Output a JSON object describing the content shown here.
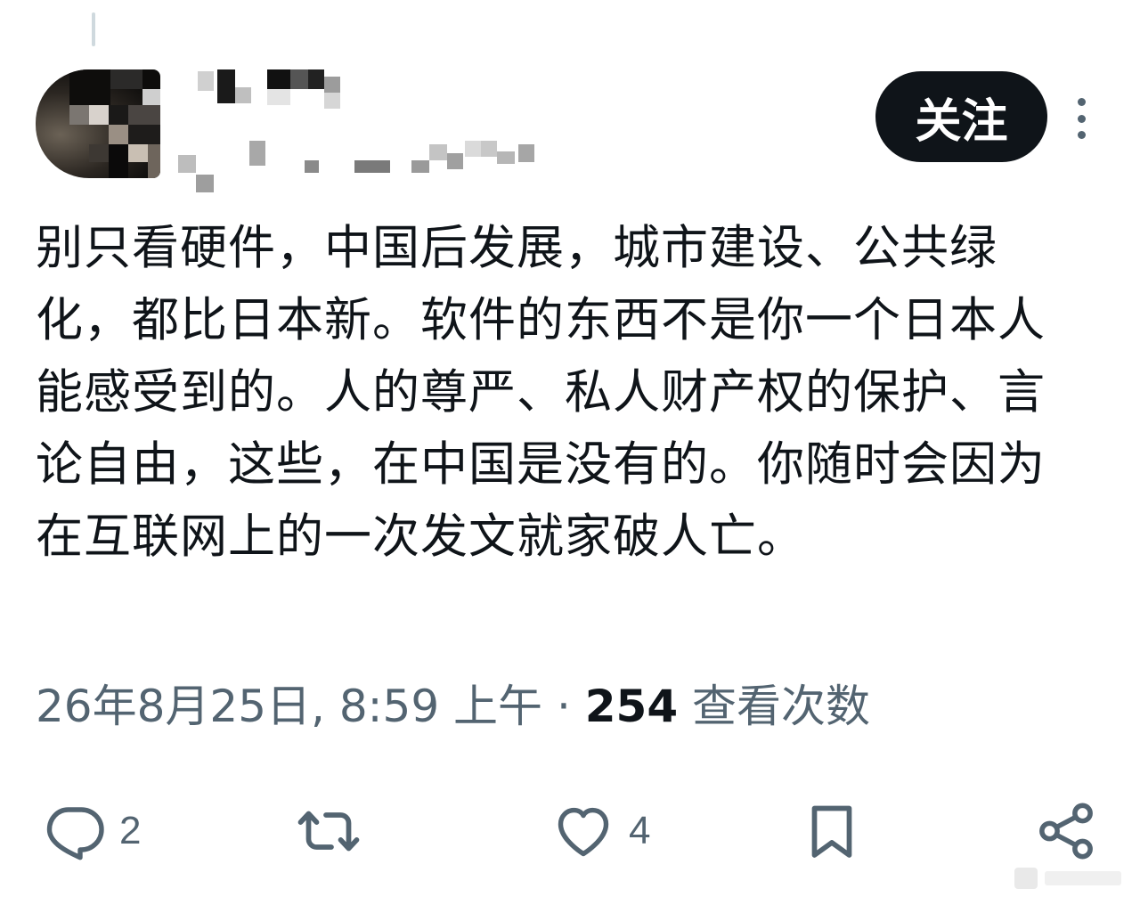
{
  "post": {
    "text": "别只看硬件，中国后发展，城市建设、公共绿化，都比日本新。软件的东西不是你一个日本人能感受到的。人的尊严、私人财产权的保护、言论自由，这些，在中国是没有的。你随时会因为在互联网上的一次发文就家破人亡。",
    "timestamp": "26年8月25日, 8:59 上午",
    "separator": "·",
    "views_count": "254",
    "views_label": "查看次数"
  },
  "header": {
    "follow_label": "关注"
  },
  "actions": {
    "reply_count": "2",
    "like_count": "4"
  },
  "icons": {
    "reply": "reply-icon",
    "retweet": "retweet-icon",
    "like": "heart-icon",
    "bookmark": "bookmark-icon",
    "share": "share-icon",
    "more": "more-vertical-icon"
  },
  "colors": {
    "text": "#0f1419",
    "secondary": "#536471",
    "button_bg": "#0f1419"
  }
}
